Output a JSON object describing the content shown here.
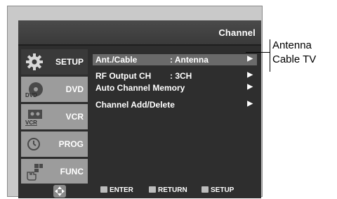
{
  "menu": {
    "title": "Channel",
    "tabs": [
      {
        "label": "SETUP",
        "icon": "gear-icon",
        "active": true
      },
      {
        "label": "DVD",
        "icon": "dvd-disc-icon",
        "icon_text": "DVD",
        "active": false
      },
      {
        "label": "VCR",
        "icon": "vcr-tape-icon",
        "icon_text": "VCR",
        "active": false
      },
      {
        "label": "PROG",
        "icon": "clock-icon",
        "active": false
      },
      {
        "label": "FUNC",
        "icon": "function-hand-icon",
        "active": false
      }
    ],
    "rows": [
      {
        "label": "Ant./Cable",
        "value": ": Antenna",
        "selected": true
      },
      {
        "label": "RF Output CH",
        "value": ": 3CH",
        "selected": false
      },
      {
        "label": "Auto Channel Memory",
        "value": "",
        "selected": false
      },
      {
        "label": "Channel Add/Delete",
        "value": "",
        "selected": false
      }
    ],
    "arrow_glyph": "▶",
    "footer": {
      "enter_label": "ENTER",
      "return_label": "RETURN",
      "setup_label": "SETUP"
    }
  },
  "callout": {
    "lines": [
      "Antenna",
      "Cable TV"
    ]
  },
  "colors": {
    "window": "#2e2e2e",
    "tab_inactive": "#9c9c9c",
    "row_selected": "#6a6a6a",
    "text": "#ffffff"
  }
}
